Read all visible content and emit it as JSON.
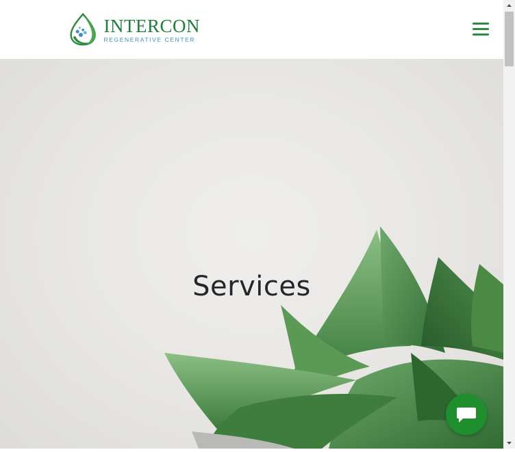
{
  "header": {
    "logo_title": "INTERCON",
    "logo_subtitle": "REGENERATIVE CENTER"
  },
  "hero": {
    "title": "Services"
  },
  "colors": {
    "brand_green": "#1e7f3a",
    "brand_blue": "#3b8fc7",
    "chat_button": "#1e8f2c"
  },
  "icons": {
    "menu": "hamburger-menu-icon",
    "chat": "chat-bubble-icon"
  }
}
